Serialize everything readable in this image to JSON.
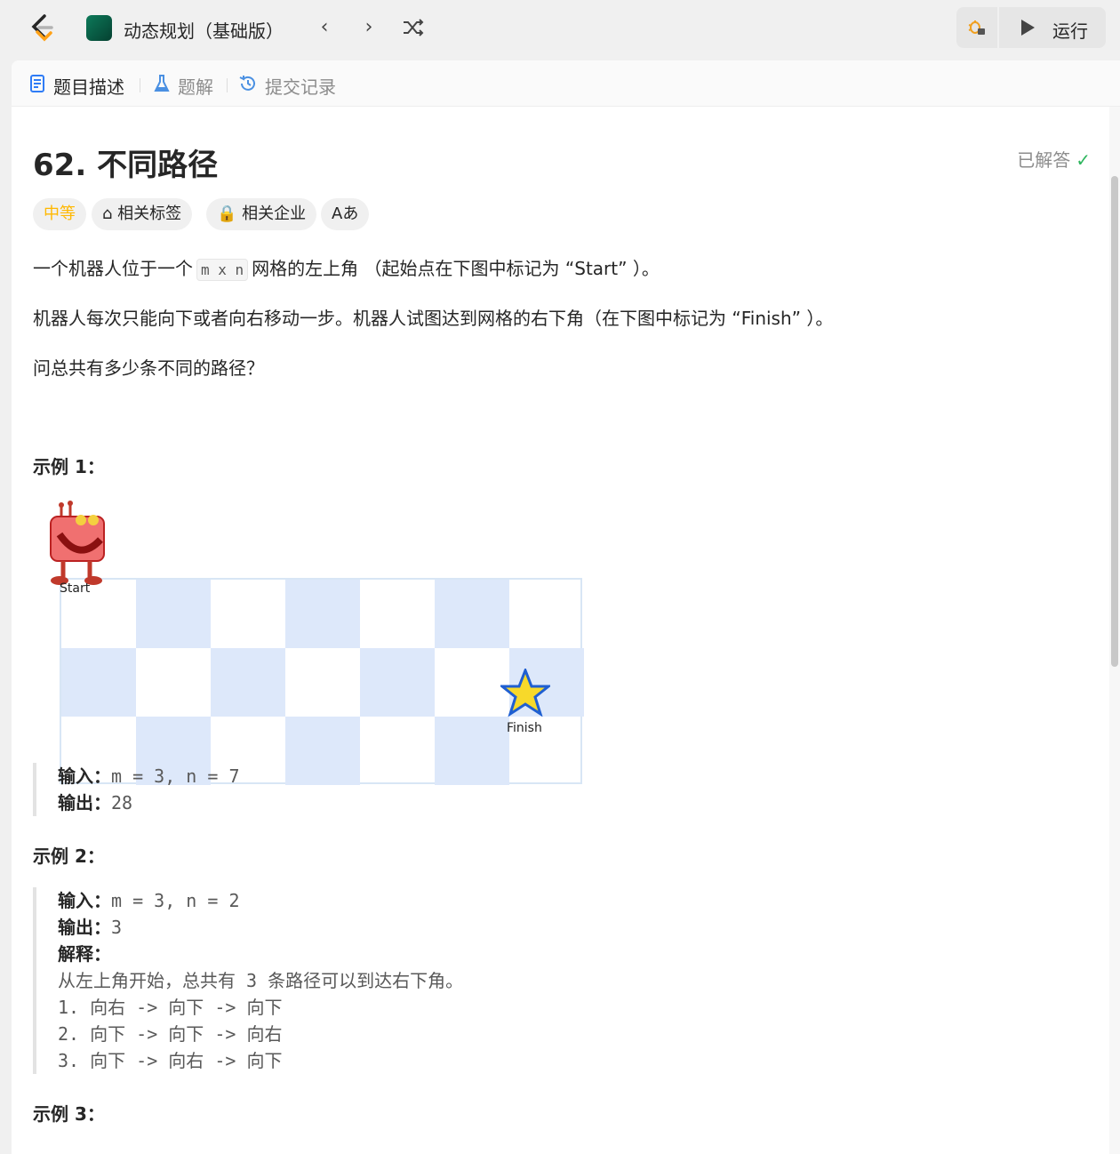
{
  "topbar": {
    "study_title": "动态规划（基础版）",
    "prev_icon": "chevron-left-icon",
    "next_icon": "chevron-right-icon",
    "shuffle_icon": "shuffle-icon",
    "debug_icon": "bug-lock-icon",
    "run_label": "运行"
  },
  "tabs": [
    {
      "label": "题目描述",
      "icon": "description-icon"
    },
    {
      "label": "题解",
      "icon": "flask-icon"
    },
    {
      "label": "提交记录",
      "icon": "history-icon"
    }
  ],
  "problem": {
    "title": "62. 不同路径",
    "status": "已解答",
    "tags": [
      "中等",
      "相关标签",
      "相关企业",
      "Aあ"
    ],
    "p1_before": "一个机器人位于一个",
    "p1_code": "m x n",
    "p1_after": "网格的左上角 （起始点在下图中标记为 “Start” ）。",
    "p2": "机器人每次只能向下或者向右移动一步。机器人试图达到网格的右下角（在下图中标记为 “Finish” ）。",
    "p3": "问总共有多少条不同的路径？"
  },
  "example1": {
    "title": "示例 1：",
    "grid_rows": 3,
    "grid_cols": 7,
    "start_label": "Start",
    "finish_label": "Finish",
    "input_label": "输入：",
    "input": "m = 3, n = 7",
    "output_label": "输出：",
    "output": "28"
  },
  "example2": {
    "title": "示例 2：",
    "input_label": "输入：",
    "input": "m = 3, n = 2",
    "output_label": "输出：",
    "output": "3",
    "explain_label": "解释：",
    "explain_before": "从左上角开始，总共有",
    "explain_num": " 3 ",
    "explain_after": "条路径可以到达右下角。",
    "paths": [
      {
        "num": "1. ",
        "a": "向右",
        "b": "向下",
        "c": "向下"
      },
      {
        "num": "2. ",
        "a": "向下",
        "b": "向下",
        "c": "向右"
      },
      {
        "num": "3. ",
        "a": "向下",
        "b": "向右",
        "c": "向下"
      }
    ],
    "arrow": " -> "
  },
  "example3": {
    "title": "示例 3："
  },
  "colors": {
    "medium": "#ffb800",
    "solved": "#2db55d",
    "grid_blue": "#dde8fa"
  }
}
